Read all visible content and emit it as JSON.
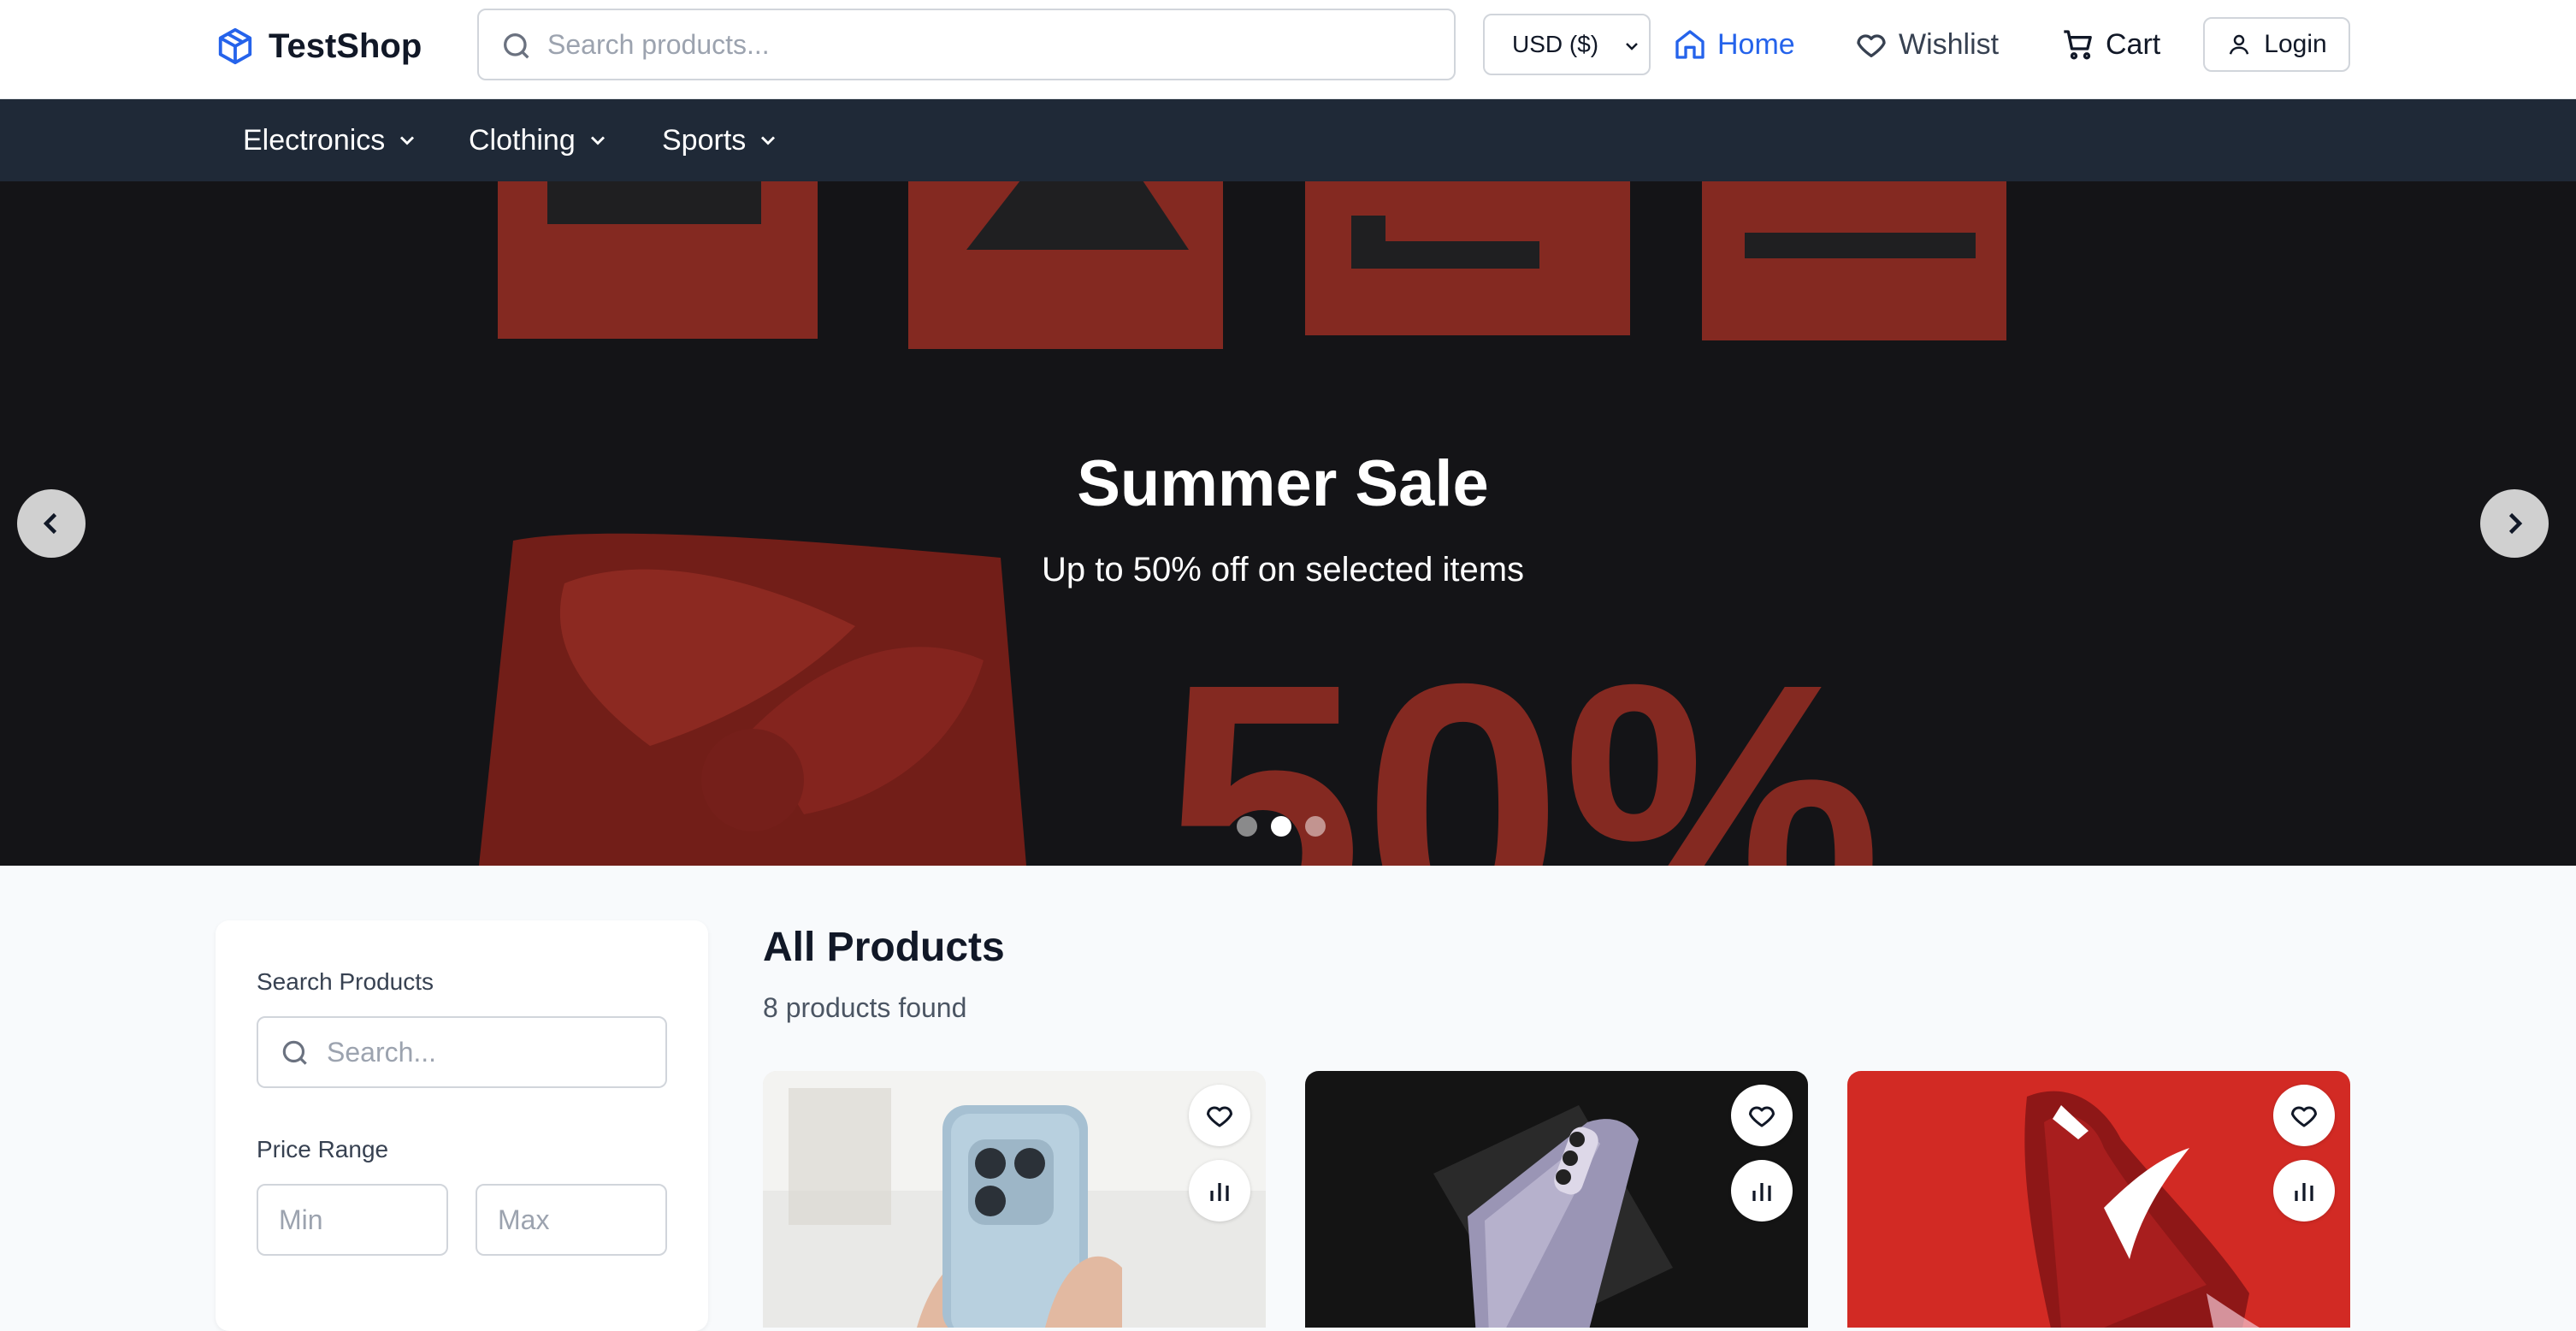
{
  "header": {
    "brand": "TestShop",
    "search_placeholder": "Search products...",
    "currency": "USD ($)",
    "nav": {
      "home": "Home",
      "wishlist": "Wishlist",
      "cart": "Cart"
    },
    "login": "Login"
  },
  "categories": [
    "Electronics",
    "Clothing",
    "Sports"
  ],
  "hero": {
    "title": "Summer Sale",
    "subtitle": "Up to 50% off on selected items",
    "slide_count": 3,
    "active_slide": 2
  },
  "filters": {
    "search_label": "Search Products",
    "search_placeholder": "Search...",
    "price_label": "Price Range",
    "min_placeholder": "Min",
    "max_placeholder": "Max"
  },
  "products": {
    "title": "All Products",
    "count_text": "8 products found"
  },
  "colors": {
    "accent": "#2563eb",
    "category_bar": "#1f2937",
    "sale_red": "#c0392b"
  }
}
